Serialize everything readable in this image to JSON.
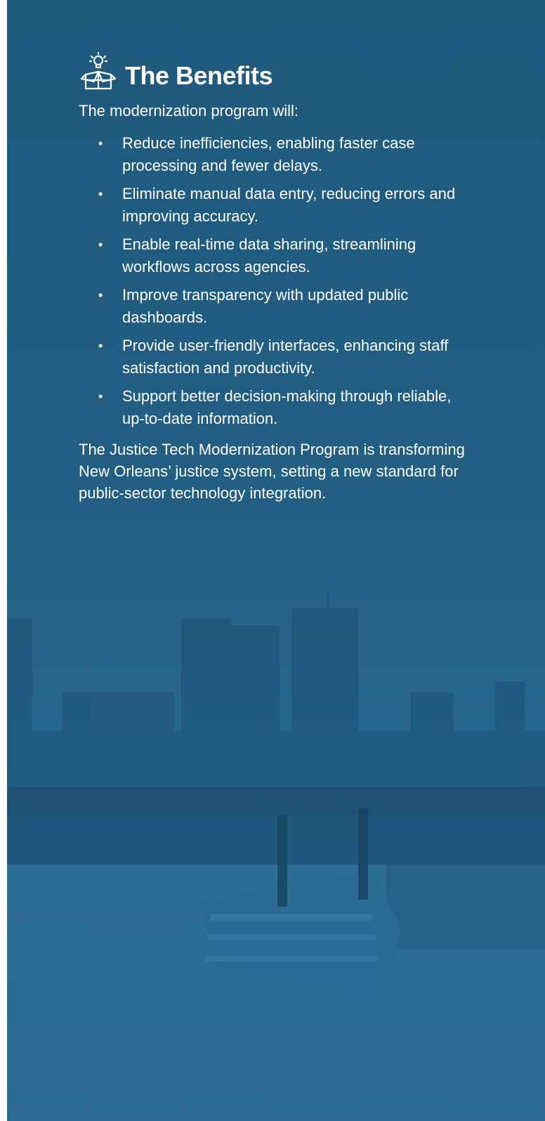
{
  "header": {
    "icon": "idea-box-icon",
    "title": "The Benefits"
  },
  "intro": "The modernization program will:",
  "benefits": [
    "Reduce inefficiencies, enabling faster case processing and fewer delays.",
    "Eliminate manual data entry, reducing errors and improving accuracy.",
    "Enable real-time data sharing, streamlining workflows across agencies.",
    "Improve transparency with updated public dashboards.",
    "Provide user-friendly interfaces, enhancing staff satisfaction and productivity.",
    "Support better decision-making through reliable, up-to-date information."
  ],
  "closing": "The Justice Tech Modernization Program is transforming New Orleans’ justice system, setting a new standard for public-sector technology integration.",
  "colors": {
    "background": "#225f83",
    "text": "#ffffff"
  },
  "background_image": "new-orleans-skyline-riverboat-photo"
}
